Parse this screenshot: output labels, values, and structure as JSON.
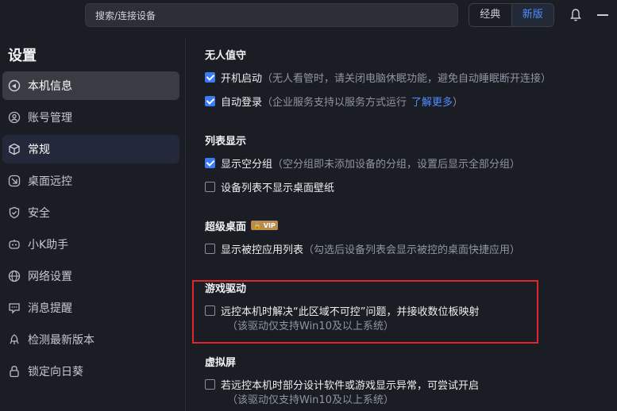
{
  "top": {
    "search_placeholder": "搜索/连接设备",
    "version_classic": "经典",
    "version_new": "新版"
  },
  "sidebar": {
    "title": "设置",
    "items": [
      {
        "label": "本机信息",
        "icon": "monitor-icon"
      },
      {
        "label": "账号管理",
        "icon": "user-icon"
      },
      {
        "label": "常规",
        "icon": "cube-icon"
      },
      {
        "label": "桌面远控",
        "icon": "remote-icon"
      },
      {
        "label": "安全",
        "icon": "shield-icon"
      },
      {
        "label": "小K助手",
        "icon": "robot-icon"
      },
      {
        "label": "网络设置",
        "icon": "globe-icon"
      },
      {
        "label": "消息提醒",
        "icon": "message-icon"
      },
      {
        "label": "检测最新版本",
        "icon": "update-icon"
      },
      {
        "label": "锁定向日葵",
        "icon": "lock-icon"
      }
    ]
  },
  "main": {
    "unattended": {
      "title": "无人值守",
      "boot_label": "开机启动",
      "boot_hint": "（无人看管时，请关闭电脑休眠功能，避免自动睡眠断开连接）",
      "autologin_label": "自动登录",
      "autologin_hint": "（企业服务支持以服务方式运行",
      "autologin_link": "了解更多",
      "autologin_close": "）"
    },
    "list_display": {
      "title": "列表显示",
      "empty_group_label": "显示空分组",
      "empty_group_hint": "（空分组即未添加设备的分组，设置后显示全部分组）",
      "wallpaper_label": "设备列表不显示桌面壁纸"
    },
    "super_desktop": {
      "title": "超级桌面",
      "vip": "VIP",
      "apps_label": "显示被控应用列表",
      "apps_hint": "（勾选后设备列表会显示被控的桌面快捷应用）"
    },
    "game_driver": {
      "title": "游戏驱动",
      "label": "远控本机时解决“此区域不可控”问题，并接收数位板映射",
      "note": "（该驱动仅支持Win10及以上系统）"
    },
    "virtual_screen": {
      "title": "虚拟屏",
      "label": "若远控本机时部分设计软件或游戏显示异常，可尝试开启",
      "note": "（该驱动仅支持Win10及以上系统）"
    }
  },
  "colors": {
    "accent": "#3a7bf6",
    "highlight_box": "#e0262a"
  }
}
